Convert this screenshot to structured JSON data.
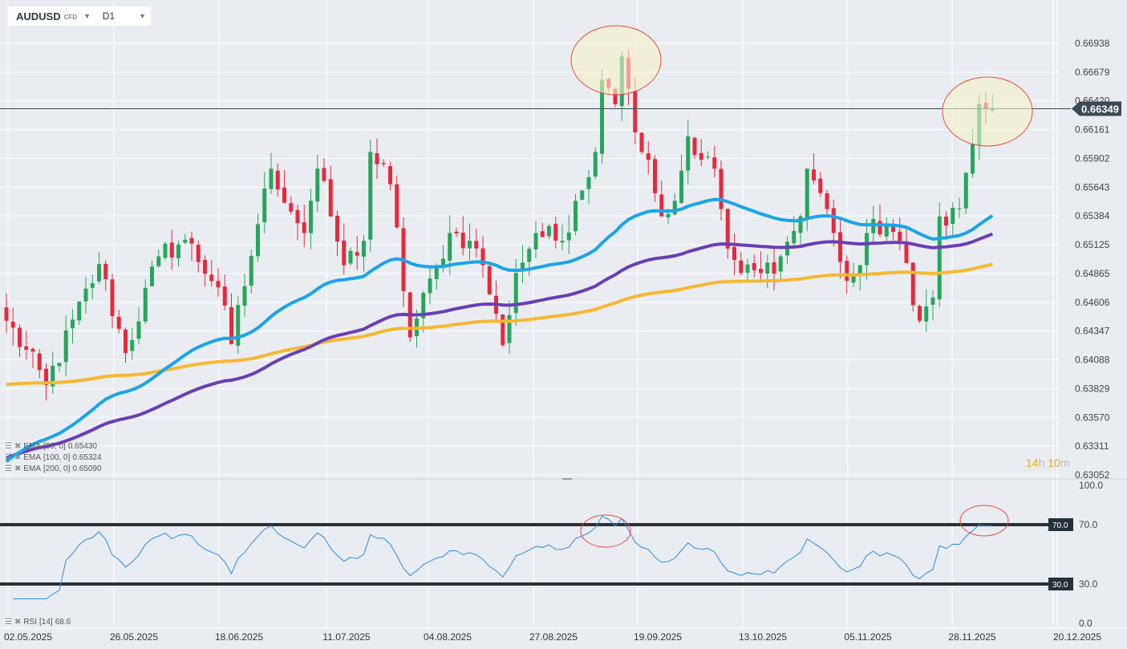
{
  "header": {
    "symbol": "AUDUSD",
    "instrument_type": "CFD",
    "timeframe": "D1"
  },
  "indicators": [
    {
      "label": "EMA",
      "params": "[50,  0]",
      "value": "0.65430",
      "color": "#1ba4e8"
    },
    {
      "label": "EMA",
      "params": "[100,  0]",
      "value": "0.65324",
      "color": "#6a3fb5"
    },
    {
      "label": "EMA",
      "params": "[200,  0]",
      "value": "0.65090",
      "color": "#f7b731"
    }
  ],
  "rsi": {
    "label": "RSI",
    "params": "[14]",
    "value": "68.6",
    "levels": [
      "70.0",
      "30.0"
    ],
    "axis": [
      "100.0",
      "70.0",
      "30.0",
      "0.0"
    ],
    "color": "#2b8be6"
  },
  "timer": {
    "hours": "14",
    "h": "h",
    "minutes": "10",
    "m": "m"
  },
  "chart_data": {
    "type": "candlestick",
    "title": "AUDUSD D1",
    "current_price": "0.66349",
    "price_ticks": [
      "0.66938",
      "0.66679",
      "0.66420",
      "0.66161",
      "0.65902",
      "0.65643",
      "0.65384",
      "0.65125",
      "0.64865",
      "0.64606",
      "0.64347",
      "0.64088",
      "0.63829",
      "0.63570",
      "0.63311",
      "0.63052"
    ],
    "ylim": [
      0.63052,
      0.66938
    ],
    "x_ticks": [
      "02.05.2025",
      "26.05.2025",
      "18.06.2025",
      "11.07.2025",
      "04.08.2025",
      "27.08.2025",
      "19.09.2025",
      "13.10.2025",
      "05.11.2025",
      "28.11.2025",
      "20.12.2025"
    ],
    "candle_count": 150,
    "close_keypoints": [
      [
        0,
        0.6444
      ],
      [
        6,
        0.6386
      ],
      [
        14,
        0.6495
      ],
      [
        18,
        0.6415
      ],
      [
        23,
        0.6502
      ],
      [
        27,
        0.6517
      ],
      [
        32,
        0.6474
      ],
      [
        34,
        0.6423
      ],
      [
        38,
        0.6531
      ],
      [
        40,
        0.6581
      ],
      [
        45,
        0.6523
      ],
      [
        47,
        0.6581
      ],
      [
        49,
        0.6538
      ],
      [
        51,
        0.6494
      ],
      [
        54,
        0.6516
      ],
      [
        55,
        0.6596
      ],
      [
        58,
        0.6567
      ],
      [
        61,
        0.6429
      ],
      [
        65,
        0.6494
      ],
      [
        67,
        0.6523
      ],
      [
        70,
        0.6516
      ],
      [
        72,
        0.6494
      ],
      [
        75,
        0.6422
      ],
      [
        77,
        0.6487
      ],
      [
        80,
        0.6523
      ],
      [
        84,
        0.6516
      ],
      [
        86,
        0.6552
      ],
      [
        89,
        0.6596
      ],
      [
        90,
        0.6661
      ],
      [
        92,
        0.6639
      ],
      [
        93,
        0.6682
      ],
      [
        94,
        0.6653
      ],
      [
        96,
        0.6596
      ],
      [
        97,
        0.6589
      ],
      [
        99,
        0.6538
      ],
      [
        101,
        0.6552
      ],
      [
        103,
        0.661
      ],
      [
        105,
        0.6589
      ],
      [
        107,
        0.6581
      ],
      [
        109,
        0.6509
      ],
      [
        111,
        0.6487
      ],
      [
        114,
        0.6487
      ],
      [
        117,
        0.6502
      ],
      [
        120,
        0.6538
      ],
      [
        121,
        0.6581
      ],
      [
        123,
        0.6559
      ],
      [
        125,
        0.6523
      ],
      [
        127,
        0.648
      ],
      [
        129,
        0.6494
      ],
      [
        130,
        0.6523
      ],
      [
        133,
        0.6531
      ],
      [
        135,
        0.6516
      ],
      [
        137,
        0.6458
      ],
      [
        138,
        0.6444
      ],
      [
        140,
        0.6465
      ],
      [
        141,
        0.6538
      ],
      [
        144,
        0.6545
      ],
      [
        146,
        0.6603
      ],
      [
        147,
        0.6639
      ],
      [
        149,
        0.6635
      ]
    ],
    "ema_seeds": {
      "ema50": 0.6312,
      "ema100": 0.6318,
      "ema200": 0.6386
    },
    "colors": {
      "up": "#26a65b",
      "down": "#e8283c"
    }
  }
}
